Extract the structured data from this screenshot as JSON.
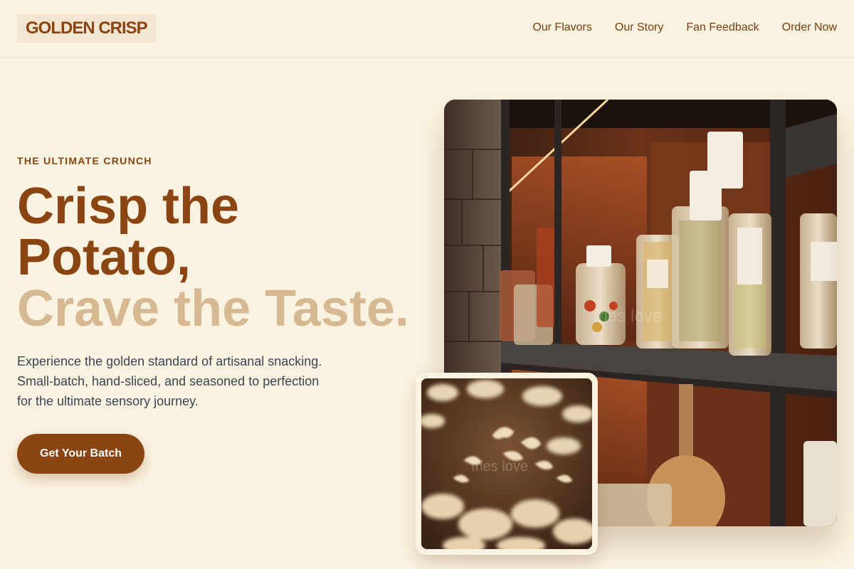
{
  "brand": {
    "logo_text": "GOLDEN CRISP",
    "primary_color": "#8b4513",
    "accent_color": "#d6b892",
    "background_color": "#fbf3e2"
  },
  "nav": {
    "items": [
      {
        "label": "Our Flavors"
      },
      {
        "label": "Our Story"
      },
      {
        "label": "Fan Feedback"
      },
      {
        "label": "Order Now"
      }
    ]
  },
  "hero": {
    "eyebrow": "THE ULTIMATE CRUNCH",
    "title_line1": "Crisp the",
    "title_line2": "Potato,",
    "title_line3": "Crave the Taste.",
    "description": "Experience the golden standard of artisanal snacking. Small-batch, hand-sliced, and seasoned to perfection for the ultimate sensory journey.",
    "cta_label": "Get Your Batch"
  },
  "images": {
    "main_watermark": "fries love",
    "inset_watermark": "fries love"
  }
}
